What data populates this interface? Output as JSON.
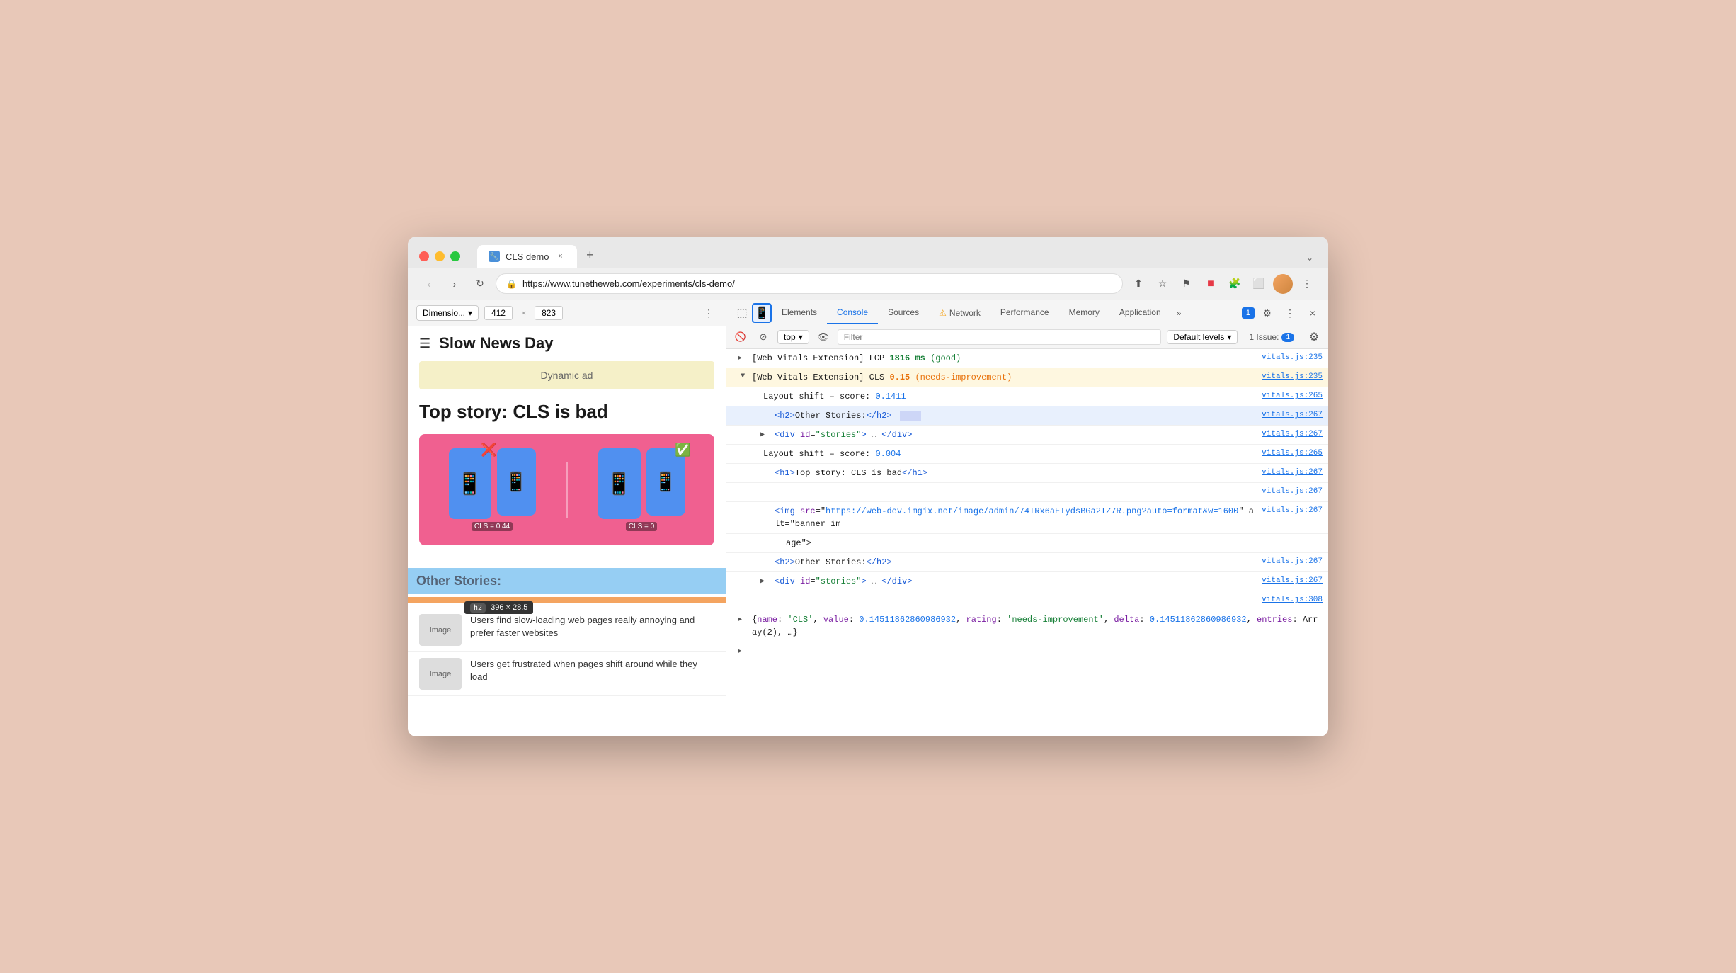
{
  "window": {
    "title": "CLS demo",
    "url": "https://www.tunetheweb.com/experiments/cls-demo/"
  },
  "tabs": [
    {
      "label": "CLS demo",
      "active": true,
      "icon": "🔧"
    }
  ],
  "devtools": {
    "tabs": [
      {
        "id": "elements",
        "label": "Elements",
        "active": false
      },
      {
        "id": "console",
        "label": "Console",
        "active": true
      },
      {
        "id": "sources",
        "label": "Sources",
        "active": false
      },
      {
        "id": "network",
        "label": "Network",
        "active": false,
        "warning": true
      },
      {
        "id": "performance",
        "label": "Performance",
        "active": false
      },
      {
        "id": "memory",
        "label": "Memory",
        "active": false
      },
      {
        "id": "application",
        "label": "Application",
        "active": false
      }
    ],
    "badge_count": "1",
    "close_label": "×",
    "overflow_label": "»",
    "issues_label": "1 Issue:",
    "issues_count": "1"
  },
  "toolbar": {
    "dimension_label": "Dimensio...",
    "width": "412",
    "height": "823",
    "top_label": "top",
    "filter_placeholder": "Filter",
    "default_levels_label": "Default levels"
  },
  "mobile_page": {
    "site_title": "Slow News Day",
    "ad_text": "Dynamic ad",
    "story_title": "Top story: CLS is bad",
    "cls_bad_label": "CLS = 0.44",
    "cls_good_label": "CLS = 0",
    "other_stories_header": "Other Stories:",
    "story1": "Users find slow-loading web pages really annoying and prefer faster websites",
    "story2": "Users get frustrated when pages shift around while they load",
    "image_label": "Image"
  },
  "console": {
    "lines": [
      {
        "id": "lcp",
        "expanded": false,
        "prefix": "[Web Vitals Extension] LCP",
        "value": "1816 ms",
        "rating": "(good)",
        "link": "vitals.js:235",
        "type": "lcp"
      },
      {
        "id": "cls",
        "expanded": true,
        "prefix": "[Web Vitals Extension] CLS",
        "value": "0.15",
        "rating": "(needs-improvement)",
        "link": "vitals.js:235",
        "type": "cls"
      },
      {
        "id": "layout-shift-1",
        "indent": 1,
        "text": "Layout shift – score:",
        "value": "0.1411",
        "link": "vitals.js:265"
      },
      {
        "id": "h2-other",
        "indent": 2,
        "tag": "<h2>Other Stories:</h2>",
        "highlighted": true,
        "link": "vitals.js:267"
      },
      {
        "id": "div-stories-1",
        "indent": 2,
        "tag_open": "<div id=\"stories\">",
        "tag_mid": "…",
        "tag_close": "</div>",
        "collapsed": true,
        "link": "vitals.js:267"
      },
      {
        "id": "layout-shift-2",
        "indent": 1,
        "text": "Layout shift – score:",
        "value": "0.004",
        "link": "vitals.js:265"
      },
      {
        "id": "h1-top",
        "indent": 2,
        "tag": "<h1>Top story: CLS is bad</h1>",
        "link": "vitals.js:267"
      },
      {
        "id": "blank-line",
        "indent": 2,
        "blank": true,
        "link": "vitals.js:267"
      },
      {
        "id": "img-tag",
        "indent": 2,
        "text_before": "<img src=\"",
        "link_text": "https://web-dev.imgix.net/image/admin/74TRx6aETydsBGa2IZ7R.png?auto=format&w=1600",
        "text_after": "\" alt=\"banner im",
        "link": "vitals.js:267",
        "continues": true
      },
      {
        "id": "img-tag-cont",
        "indent": 3,
        "text": "age\">"
      },
      {
        "id": "h2-other-2",
        "indent": 2,
        "tag": "<h2>Other Stories:</h2>",
        "link": "vitals.js:267"
      },
      {
        "id": "div-stories-2",
        "indent": 2,
        "tag_open": "<div id=\"stories\">",
        "tag_mid": "…",
        "tag_close": "</div>",
        "collapsed": true,
        "link": "vitals.js:267"
      },
      {
        "id": "vitals-308",
        "blank": true,
        "link": "vitals.js:308"
      },
      {
        "id": "cls-object",
        "indent": 0,
        "expandable": true,
        "text": "{name: 'CLS', value: 0.14511862860986932, rating: 'needs-improvement', delta: 0.14511862860986932, entries: Array(2), …}",
        "link": ""
      },
      {
        "id": "arrow-end",
        "indent": 0,
        "arrow_only": true
      }
    ]
  }
}
